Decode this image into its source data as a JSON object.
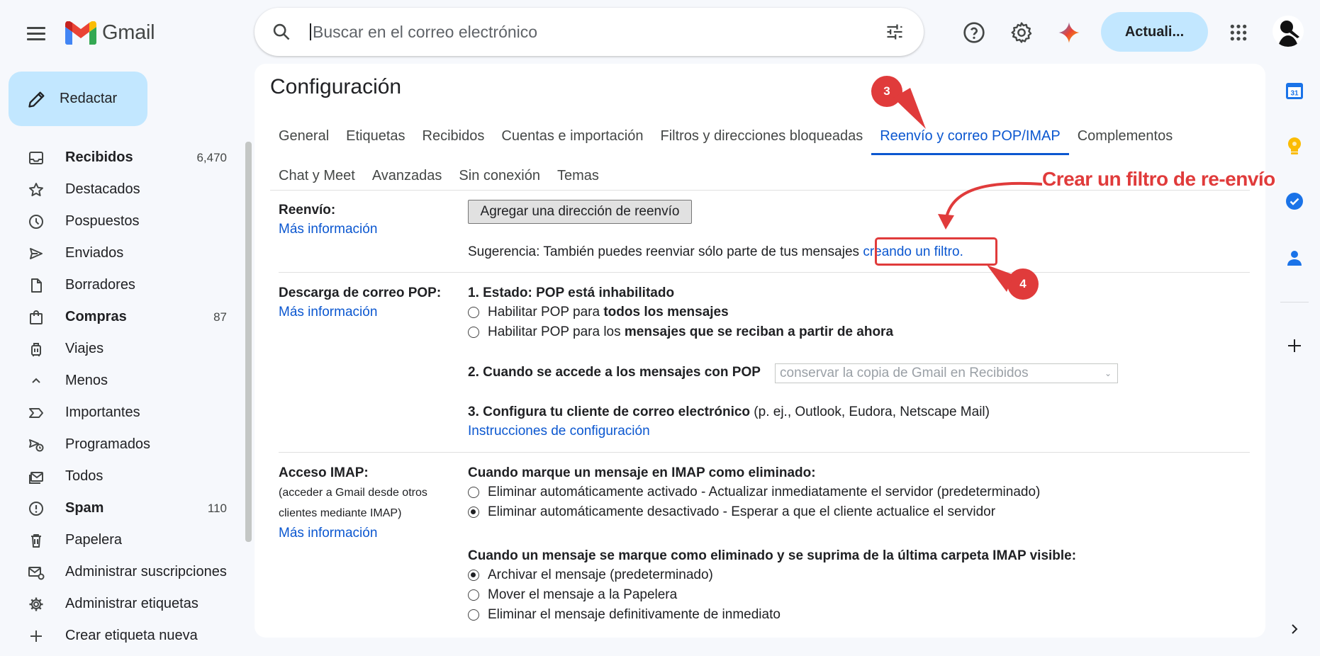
{
  "app": {
    "name": "Gmail"
  },
  "header": {
    "search_placeholder": "Buscar en el correo electrónico",
    "update_label": "Actuali..."
  },
  "sidebar": {
    "compose_label": "Redactar",
    "items": [
      {
        "label": "Recibidos",
        "count": "6,470",
        "bold": true,
        "icon": "inbox-icon"
      },
      {
        "label": "Destacados",
        "count": "",
        "bold": false,
        "icon": "star-icon"
      },
      {
        "label": "Pospuestos",
        "count": "",
        "bold": false,
        "icon": "clock-icon"
      },
      {
        "label": "Enviados",
        "count": "",
        "bold": false,
        "icon": "send-icon"
      },
      {
        "label": "Borradores",
        "count": "",
        "bold": false,
        "icon": "draft-icon"
      },
      {
        "label": "Compras",
        "count": "87",
        "bold": true,
        "icon": "shopping-bag-icon"
      },
      {
        "label": "Viajes",
        "count": "",
        "bold": false,
        "icon": "luggage-icon"
      },
      {
        "label": "Menos",
        "count": "",
        "bold": false,
        "icon": "chevron-up-icon"
      },
      {
        "label": "Importantes",
        "count": "",
        "bold": false,
        "icon": "important-icon"
      },
      {
        "label": "Programados",
        "count": "",
        "bold": false,
        "icon": "scheduled-send-icon"
      },
      {
        "label": "Todos",
        "count": "",
        "bold": false,
        "icon": "all-mail-icon"
      },
      {
        "label": "Spam",
        "count": "110",
        "bold": true,
        "icon": "spam-icon"
      },
      {
        "label": "Papelera",
        "count": "",
        "bold": false,
        "icon": "trash-icon"
      },
      {
        "label": "Administrar suscripciones",
        "count": "",
        "bold": false,
        "icon": "manage-subscriptions-icon"
      },
      {
        "label": "Administrar etiquetas",
        "count": "",
        "bold": false,
        "icon": "gear-icon"
      },
      {
        "label": "Crear etiqueta nueva",
        "count": "",
        "bold": false,
        "icon": "plus-icon"
      }
    ]
  },
  "settings": {
    "title": "Configuración",
    "tabs_row1": [
      "General",
      "Etiquetas",
      "Recibidos",
      "Cuentas e importación",
      "Filtros y direcciones bloqueadas",
      "Reenvío y correo POP/IMAP",
      "Complementos"
    ],
    "tabs_row2": [
      "Chat y Meet",
      "Avanzadas",
      "Sin conexión",
      "Temas"
    ],
    "active_tab": "Reenvío y correo POP/IMAP",
    "forwarding": {
      "label": "Reenvío:",
      "more_info": "Más información",
      "add_button": "Agregar una dirección de reenvío",
      "tip_text": "Sugerencia: También puedes reenviar sólo parte de tus mensajes",
      "tip_link": "creando un filtro."
    },
    "pop": {
      "label": "Descarga de correo POP:",
      "more_info": "Más información",
      "status": "1. Estado: POP está inhabilitado",
      "opt1_prefix": "Habilitar POP para ",
      "opt1_bold": "todos los mensajes",
      "opt2_prefix": "Habilitar POP para los ",
      "opt2_bold": "mensajes que se reciban a partir de ahora",
      "when_access": "2. Cuando se accede a los mensajes con POP",
      "select_value": "conservar la copia de Gmail en Recibidos",
      "configure_bold": "3. Configura tu cliente de correo electrónico",
      "configure_rest": " (p. ej., Outlook, Eudora, Netscape Mail)",
      "instructions_link": "Instrucciones de configuración"
    },
    "imap": {
      "label": "Acceso IMAP:",
      "sub1": "(acceder a Gmail desde otros",
      "sub2": "clientes mediante IMAP)",
      "more_info": "Más información",
      "q1": "Cuando marque un mensaje en IMAP como eliminado:",
      "q1_opt1": "Eliminar automáticamente activado - Actualizar inmediatamente el servidor (predeterminado)",
      "q1_opt2": "Eliminar automáticamente desactivado - Esperar a que el cliente actualice el servidor",
      "q2": "Cuando un mensaje se marque como eliminado y se suprima de la última carpeta IMAP visible:",
      "q2_opt1": "Archivar el mensaje (predeterminado)",
      "q2_opt2": "Mover el mensaje a la Papelera",
      "q2_opt3": "Eliminar el mensaje definitivamente de inmediato"
    }
  },
  "annotations": {
    "step3": "3",
    "step4": "4",
    "callout": "Crear un filtro de re-envío",
    "color": "#e03b3b"
  },
  "rail": {
    "calendar_day": "31"
  }
}
